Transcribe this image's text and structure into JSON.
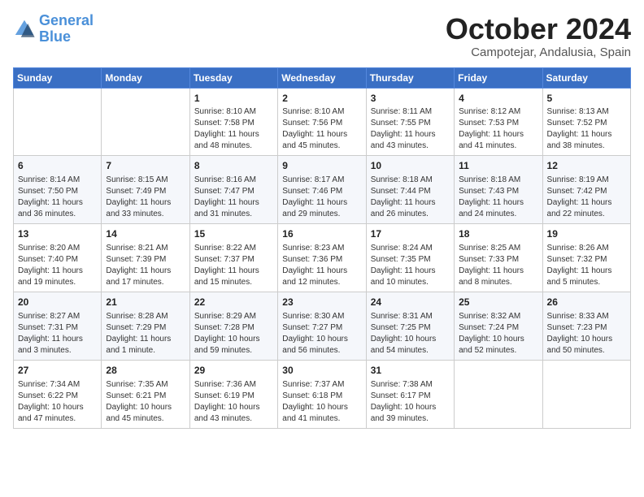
{
  "header": {
    "logo_line1": "General",
    "logo_line2": "Blue",
    "month": "October 2024",
    "location": "Campotejar, Andalusia, Spain"
  },
  "weekdays": [
    "Sunday",
    "Monday",
    "Tuesday",
    "Wednesday",
    "Thursday",
    "Friday",
    "Saturday"
  ],
  "weeks": [
    [
      {
        "day": "",
        "info": ""
      },
      {
        "day": "",
        "info": ""
      },
      {
        "day": "1",
        "info": "Sunrise: 8:10 AM\nSunset: 7:58 PM\nDaylight: 11 hours and 48 minutes."
      },
      {
        "day": "2",
        "info": "Sunrise: 8:10 AM\nSunset: 7:56 PM\nDaylight: 11 hours and 45 minutes."
      },
      {
        "day": "3",
        "info": "Sunrise: 8:11 AM\nSunset: 7:55 PM\nDaylight: 11 hours and 43 minutes."
      },
      {
        "day": "4",
        "info": "Sunrise: 8:12 AM\nSunset: 7:53 PM\nDaylight: 11 hours and 41 minutes."
      },
      {
        "day": "5",
        "info": "Sunrise: 8:13 AM\nSunset: 7:52 PM\nDaylight: 11 hours and 38 minutes."
      }
    ],
    [
      {
        "day": "6",
        "info": "Sunrise: 8:14 AM\nSunset: 7:50 PM\nDaylight: 11 hours and 36 minutes."
      },
      {
        "day": "7",
        "info": "Sunrise: 8:15 AM\nSunset: 7:49 PM\nDaylight: 11 hours and 33 minutes."
      },
      {
        "day": "8",
        "info": "Sunrise: 8:16 AM\nSunset: 7:47 PM\nDaylight: 11 hours and 31 minutes."
      },
      {
        "day": "9",
        "info": "Sunrise: 8:17 AM\nSunset: 7:46 PM\nDaylight: 11 hours and 29 minutes."
      },
      {
        "day": "10",
        "info": "Sunrise: 8:18 AM\nSunset: 7:44 PM\nDaylight: 11 hours and 26 minutes."
      },
      {
        "day": "11",
        "info": "Sunrise: 8:18 AM\nSunset: 7:43 PM\nDaylight: 11 hours and 24 minutes."
      },
      {
        "day": "12",
        "info": "Sunrise: 8:19 AM\nSunset: 7:42 PM\nDaylight: 11 hours and 22 minutes."
      }
    ],
    [
      {
        "day": "13",
        "info": "Sunrise: 8:20 AM\nSunset: 7:40 PM\nDaylight: 11 hours and 19 minutes."
      },
      {
        "day": "14",
        "info": "Sunrise: 8:21 AM\nSunset: 7:39 PM\nDaylight: 11 hours and 17 minutes."
      },
      {
        "day": "15",
        "info": "Sunrise: 8:22 AM\nSunset: 7:37 PM\nDaylight: 11 hours and 15 minutes."
      },
      {
        "day": "16",
        "info": "Sunrise: 8:23 AM\nSunset: 7:36 PM\nDaylight: 11 hours and 12 minutes."
      },
      {
        "day": "17",
        "info": "Sunrise: 8:24 AM\nSunset: 7:35 PM\nDaylight: 11 hours and 10 minutes."
      },
      {
        "day": "18",
        "info": "Sunrise: 8:25 AM\nSunset: 7:33 PM\nDaylight: 11 hours and 8 minutes."
      },
      {
        "day": "19",
        "info": "Sunrise: 8:26 AM\nSunset: 7:32 PM\nDaylight: 11 hours and 5 minutes."
      }
    ],
    [
      {
        "day": "20",
        "info": "Sunrise: 8:27 AM\nSunset: 7:31 PM\nDaylight: 11 hours and 3 minutes."
      },
      {
        "day": "21",
        "info": "Sunrise: 8:28 AM\nSunset: 7:29 PM\nDaylight: 11 hours and 1 minute."
      },
      {
        "day": "22",
        "info": "Sunrise: 8:29 AM\nSunset: 7:28 PM\nDaylight: 10 hours and 59 minutes."
      },
      {
        "day": "23",
        "info": "Sunrise: 8:30 AM\nSunset: 7:27 PM\nDaylight: 10 hours and 56 minutes."
      },
      {
        "day": "24",
        "info": "Sunrise: 8:31 AM\nSunset: 7:25 PM\nDaylight: 10 hours and 54 minutes."
      },
      {
        "day": "25",
        "info": "Sunrise: 8:32 AM\nSunset: 7:24 PM\nDaylight: 10 hours and 52 minutes."
      },
      {
        "day": "26",
        "info": "Sunrise: 8:33 AM\nSunset: 7:23 PM\nDaylight: 10 hours and 50 minutes."
      }
    ],
    [
      {
        "day": "27",
        "info": "Sunrise: 7:34 AM\nSunset: 6:22 PM\nDaylight: 10 hours and 47 minutes."
      },
      {
        "day": "28",
        "info": "Sunrise: 7:35 AM\nSunset: 6:21 PM\nDaylight: 10 hours and 45 minutes."
      },
      {
        "day": "29",
        "info": "Sunrise: 7:36 AM\nSunset: 6:19 PM\nDaylight: 10 hours and 43 minutes."
      },
      {
        "day": "30",
        "info": "Sunrise: 7:37 AM\nSunset: 6:18 PM\nDaylight: 10 hours and 41 minutes."
      },
      {
        "day": "31",
        "info": "Sunrise: 7:38 AM\nSunset: 6:17 PM\nDaylight: 10 hours and 39 minutes."
      },
      {
        "day": "",
        "info": ""
      },
      {
        "day": "",
        "info": ""
      }
    ]
  ]
}
